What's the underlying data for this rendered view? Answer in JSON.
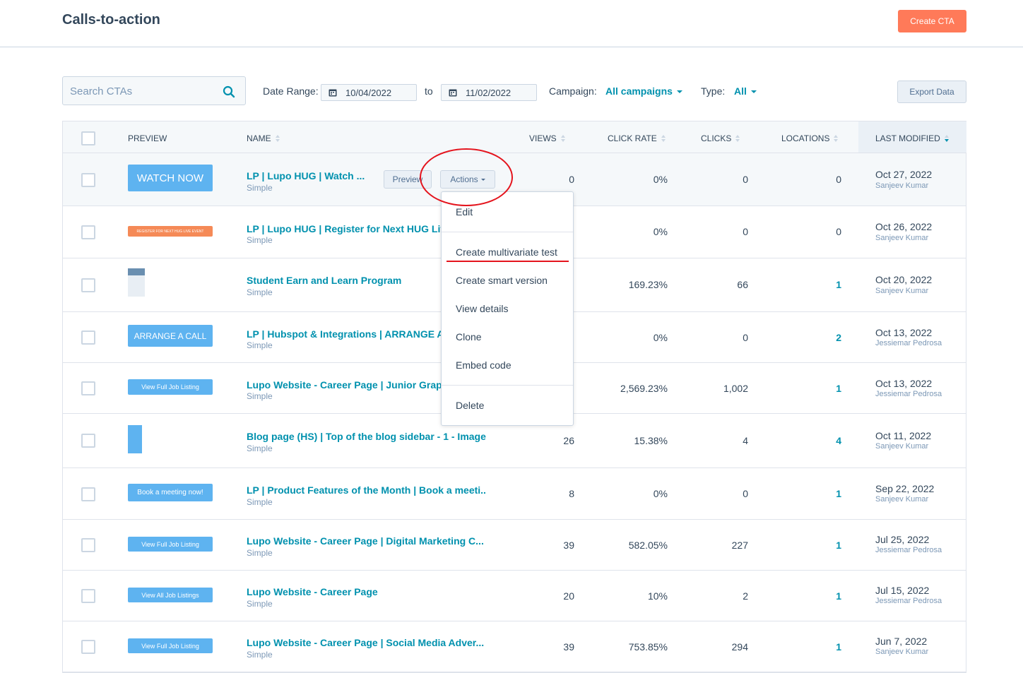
{
  "header": {
    "title": "Calls-to-action",
    "create_label": "Create CTA"
  },
  "filters": {
    "search_placeholder": "Search CTAs",
    "date_range_label": "Date Range:",
    "date_from": "10/04/2022",
    "to_label": "to",
    "date_to": "11/02/2022",
    "campaign_label": "Campaign:",
    "campaign_value": "All campaigns",
    "type_label": "Type:",
    "type_value": "All",
    "export_label": "Export Data"
  },
  "columns": {
    "preview": "PREVIEW",
    "name": "NAME",
    "views": "VIEWS",
    "click_rate": "CLICK RATE",
    "clicks": "CLICKS",
    "locations": "LOCATIONS",
    "last_modified": "LAST MODIFIED"
  },
  "hover_actions": {
    "preview_label": "Preview",
    "actions_label": "Actions"
  },
  "rows": [
    {
      "preview_text": "WATCH NOW",
      "name": "LP | Lupo HUG | Watch ...",
      "type": "Simple",
      "views": "0",
      "click_rate": "0%",
      "clicks": "0",
      "locations": "0",
      "date": "Oct 27, 2022",
      "author": "Sanjeev Kumar"
    },
    {
      "preview_text": "REGISTER FOR NEXT HUG LIVE EVENT",
      "name": "LP | Lupo HUG | Register for Next HUG Live",
      "type": "Simple",
      "views": "",
      "click_rate": "0%",
      "clicks": "0",
      "locations": "0",
      "date": "Oct 26, 2022",
      "author": "Sanjeev Kumar"
    },
    {
      "preview_text": "",
      "name": "Student Earn and Learn Program",
      "type": "Simple",
      "views": "",
      "click_rate": "169.23%",
      "clicks": "66",
      "locations": "1",
      "date": "Oct 20, 2022",
      "author": "Sanjeev Kumar"
    },
    {
      "preview_text": "ARRANGE A CALL",
      "name": "LP | Hubspot & Integrations | ARRANGE A C",
      "type": "Simple",
      "views": "",
      "click_rate": "0%",
      "clicks": "0",
      "locations": "2",
      "date": "Oct 13, 2022",
      "author": "Jessiemar Pedrosa"
    },
    {
      "preview_text": "View Full Job Listing",
      "name": "Lupo Website - Career Page | Junior Graph",
      "type": "Simple",
      "views": "",
      "click_rate": "2,569.23%",
      "clicks": "1,002",
      "locations": "1",
      "date": "Oct 13, 2022",
      "author": "Jessiemar Pedrosa"
    },
    {
      "preview_text": "",
      "name": "Blog page (HS) | Top of the blog sidebar - 1 - Image",
      "type": "Simple",
      "views": "26",
      "click_rate": "15.38%",
      "clicks": "4",
      "locations": "4",
      "date": "Oct 11, 2022",
      "author": "Sanjeev Kumar"
    },
    {
      "preview_text": "Book a meeting now!",
      "name": "LP | Product Features of the Month | Book a meeti...",
      "type": "Simple",
      "views": "8",
      "click_rate": "0%",
      "clicks": "0",
      "locations": "1",
      "date": "Sep 22, 2022",
      "author": "Sanjeev Kumar"
    },
    {
      "preview_text": "View Full Job Listing",
      "name": "Lupo Website - Career Page | Digital Marketing C...",
      "type": "Simple",
      "views": "39",
      "click_rate": "582.05%",
      "clicks": "227",
      "locations": "1",
      "date": "Jul 25, 2022",
      "author": "Jessiemar Pedrosa"
    },
    {
      "preview_text": "View All Job Listings",
      "name": "Lupo Website - Career Page",
      "type": "Simple",
      "views": "20",
      "click_rate": "10%",
      "clicks": "2",
      "locations": "1",
      "date": "Jul 15, 2022",
      "author": "Jessiemar Pedrosa"
    },
    {
      "preview_text": "View Full Job Listing",
      "name": "Lupo Website - Career Page | Social Media Adver...",
      "type": "Simple",
      "views": "39",
      "click_rate": "753.85%",
      "clicks": "294",
      "locations": "1",
      "date": "Jun 7, 2022",
      "author": "Sanjeev Kumar"
    }
  ],
  "actions_menu": {
    "edit": "Edit",
    "create_multivariate": "Create multivariate test",
    "create_smart": "Create smart version",
    "view_details": "View details",
    "clone": "Clone",
    "embed_code": "Embed code",
    "delete": "Delete"
  },
  "colors": {
    "accent": "#ff7a59",
    "link": "#0091ae",
    "cta_blue": "#5eb3f0",
    "annotation_red": "#e4141d"
  }
}
